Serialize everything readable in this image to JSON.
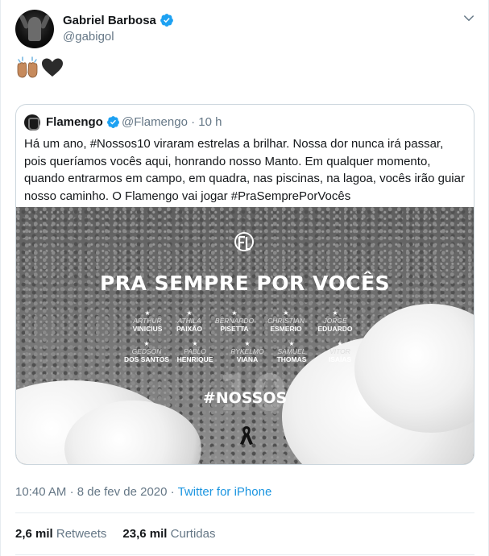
{
  "tweet": {
    "author_name": "Gabriel Barbosa",
    "author_handle": "@gabigol",
    "verified_icon": "verified-badge-icon",
    "emojis": [
      "raising-hands-icon",
      "black-heart-icon"
    ],
    "colors": {
      "accent": "#1da1f2",
      "link": "#1b95e0",
      "secondary_text": "#657786",
      "border": "#ccd6dd"
    }
  },
  "quote": {
    "author_name": "Flamengo",
    "author_handle": "@Flamengo",
    "separator": "·",
    "time_ago": "10 h",
    "text": "Há um ano, #Nossos10 viraram estrelas a brilhar. Nossa dor nunca irá passar, pois queríamos vocês aqui, honrando nosso Manto. Em qualquer momento, quando entrarmos em campo, em quadra, nas piscinas, na lagoa, vocês irão guiar nosso caminho. O Flamengo vai jogar #PraSemprePorVocês",
    "image": {
      "title": "PRA SEMPRE POR VOCÊS",
      "number": "10",
      "hashtag": "#NOSSOS",
      "names_row1": [
        {
          "first": "ARTHUR",
          "last": "VINICIUS"
        },
        {
          "first": "ATHILA",
          "last": "PAIXÃO"
        },
        {
          "first": "BERNARDO",
          "last": "PISETTA"
        },
        {
          "first": "CHRISTIAN",
          "last": "ESMERIO"
        },
        {
          "first": "JORGE",
          "last": "EDUARDO"
        }
      ],
      "names_row2": [
        {
          "first": "GEDSON",
          "last": "DOS SANTOS"
        },
        {
          "first": "PABLO",
          "last": "HENRIQUE"
        },
        {
          "first": "RYKELMO",
          "last": "VIANA"
        },
        {
          "first": "SAMUEL",
          "last": "THOMAS"
        },
        {
          "first": "VITOR",
          "last": "ISAÍAS"
        }
      ]
    }
  },
  "meta": {
    "time": "10:40 AM",
    "separator": "·",
    "date": "8 de fev de 2020",
    "via": "Twitter for iPhone"
  },
  "stats": {
    "retweets_count": "2,6 mil",
    "retweets_label": "Retweets",
    "likes_count": "23,6 mil",
    "likes_label": "Curtidas"
  }
}
